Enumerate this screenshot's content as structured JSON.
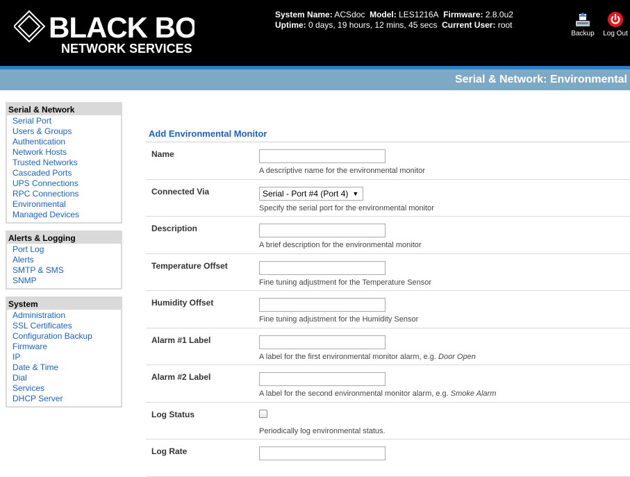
{
  "brand": {
    "name": "BLACK BOX",
    "tagline": "NETWORK SERVICES"
  },
  "sysinfo": {
    "line1": [
      {
        "k": "System Name:",
        "v": "ACSdoc"
      },
      {
        "k": "Model:",
        "v": "LES1216A"
      },
      {
        "k": "Firmware:",
        "v": "2.8.0u2"
      }
    ],
    "line2": [
      {
        "k": "Uptime:",
        "v": "0 days, 19 hours, 12 mins, 45 secs"
      },
      {
        "k": "Current User:",
        "v": "root"
      }
    ]
  },
  "header_buttons": {
    "backup": "Backup",
    "logout": "Log Out"
  },
  "page_title": "Serial & Network: Environmental",
  "sidebar": [
    {
      "title": "Serial & Network",
      "items": [
        "Serial Port",
        "Users & Groups",
        "Authentication",
        "Network Hosts",
        "Trusted Networks",
        "Cascaded Ports",
        "UPS Connections",
        "RPC Connections",
        "Environmental",
        "Managed Devices"
      ]
    },
    {
      "title": "Alerts & Logging",
      "items": [
        "Port Log",
        "Alerts",
        "SMTP & SMS",
        "SNMP"
      ]
    },
    {
      "title": "System",
      "items": [
        "Administration",
        "SSL Certificates",
        "Configuration Backup",
        "Firmware",
        "IP",
        "Date & Time",
        "Dial",
        "Services",
        "DHCP Server"
      ]
    }
  ],
  "form": {
    "title": "Add Environmental Monitor",
    "fields": [
      {
        "label": "Name",
        "type": "text",
        "value": "",
        "help": "A descriptive name for the environmental monitor"
      },
      {
        "label": "Connected Via",
        "type": "select",
        "value": "Serial - Port #4 (Port 4)",
        "help": "Specify the serial port for the environmental monitor"
      },
      {
        "label": "Description",
        "type": "text",
        "value": "",
        "help": "A brief description for the environmental monitor"
      },
      {
        "label": "Temperature Offset",
        "type": "text",
        "value": "",
        "help": "Fine tuning adjustment for the Temperature Sensor"
      },
      {
        "label": "Humidity Offset",
        "type": "text",
        "value": "",
        "help": "Fine tuning adjustment for the Humidity Sensor"
      },
      {
        "label": "Alarm #1 Label",
        "type": "text",
        "value": "",
        "help": "A label for the first environmental monitor alarm, e.g.",
        "help_em": "Door Open"
      },
      {
        "label": "Alarm #2 Label",
        "type": "text",
        "value": "",
        "help": "A label for the second environmental monitor alarm, e.g.",
        "help_em": "Smoke Alarm"
      },
      {
        "label": "Log Status",
        "type": "checkbox",
        "checked": false,
        "help": "Periodically log environmental status."
      },
      {
        "label": "Log Rate",
        "type": "text",
        "value": "",
        "help": ""
      }
    ]
  },
  "colors": {
    "accent": "#1a62c8",
    "title_bar": "#7ea9c4",
    "blue_line": "#2e7fc4",
    "logout_red": "#e8161b"
  },
  "icons": {
    "backup": "backup-icon",
    "logout": "power-icon",
    "logo": "diamond-logo-icon",
    "dropdown": "chevron-down-icon"
  }
}
